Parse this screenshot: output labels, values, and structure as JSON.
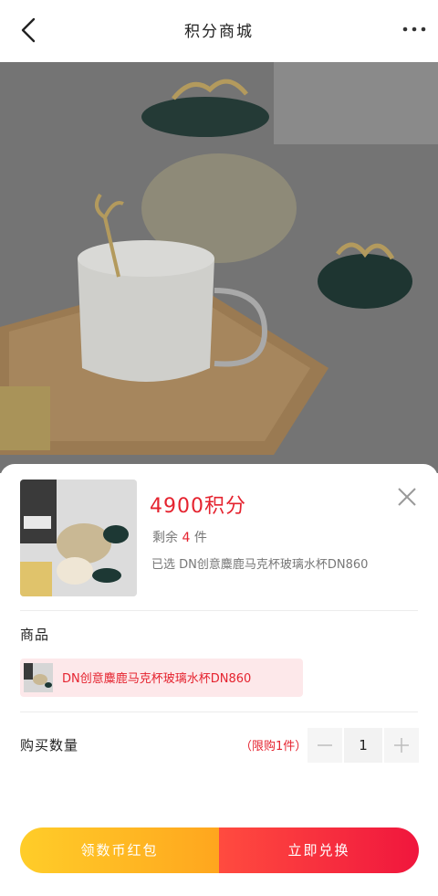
{
  "header": {
    "title": "积分商城",
    "back_icon": "chevron-left-icon",
    "more_icon": "more-dots-icon"
  },
  "sheet": {
    "price": "4900积分",
    "stock_label": "剩余",
    "stock_count": "4",
    "stock_unit": "件",
    "selected_text": "已选 DN创意麋鹿马克杯玻璃水杯DN860",
    "section_product": "商品",
    "product_name": "DN创意麋鹿马克杯玻璃水杯DN860",
    "section_quantity": "购买数量",
    "limit_text": "（限购1件）",
    "quantity": "1",
    "left_button": "领数币红包",
    "right_button": "立即兑换",
    "close_icon": "close-icon"
  },
  "colors": {
    "accent_red": "#e5232f",
    "button_yellow": "#ffb922",
    "button_red": "#f22a3e"
  }
}
